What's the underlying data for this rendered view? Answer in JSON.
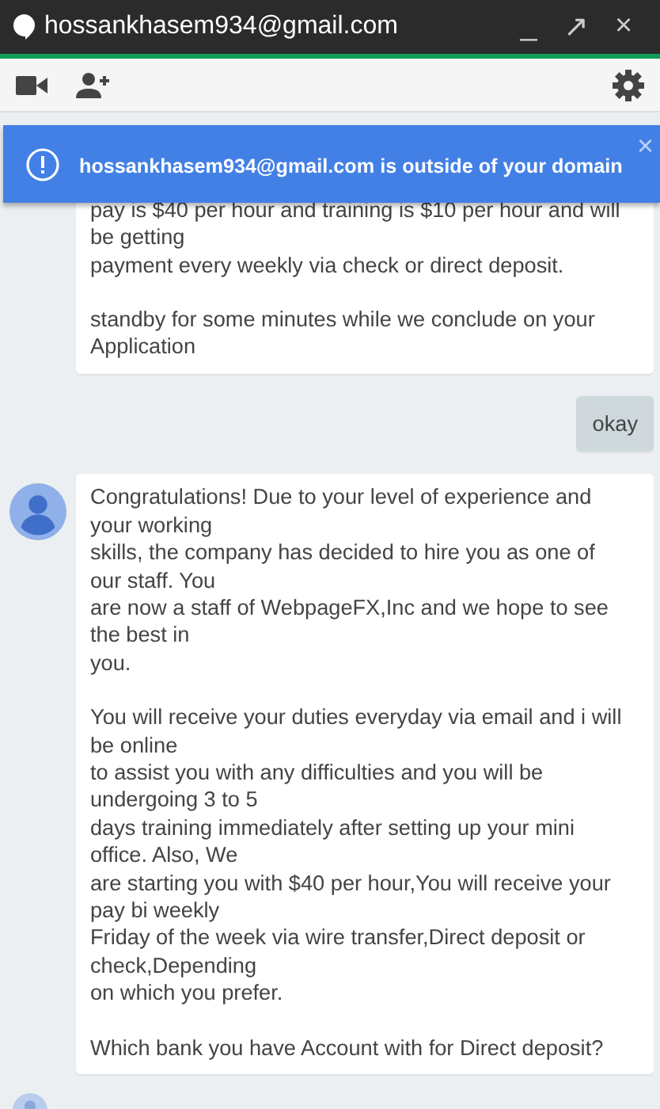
{
  "window": {
    "title": "hossankhasem934@gmail.com",
    "controls": [
      "_",
      "↗",
      "×"
    ]
  },
  "banner": {
    "text": "hossankhasem934@gmail.com is outside of your domain",
    "close": "×"
  },
  "messages": [
    {
      "kind": "received",
      "show_avatar": false,
      "paragraphs": [
        "pay is $40 per hour and training is $10 per hour and will\nbe getting\npayment every weekly via check or direct deposit.",
        "standby for some minutes while we conclude on your\nApplication"
      ]
    },
    {
      "kind": "sent",
      "paragraphs": [
        "okay"
      ]
    },
    {
      "kind": "received",
      "show_avatar": true,
      "paragraphs": [
        "Congratulations! Due to your level of experience and\nyour working\nskills, the company has decided to hire you as one of\nour staff. You\nare now a staff of WebpageFX,Inc and we hope to see\nthe best in\nyou.",
        "You will receive your duties everyday via email and i will\nbe online\nto assist you with any difficulties and you will be\nundergoing 3 to 5\ndays training immediately after setting up your mini\noffice. Also, We\nare starting you with $40 per hour,You will receive your\npay bi weekly\nFriday of the week via wire transfer,Direct deposit or\ncheck,Depending\non which you prefer.",
        "Which bank you have Account with for Direct deposit?"
      ]
    }
  ],
  "seen_avatar": true
}
